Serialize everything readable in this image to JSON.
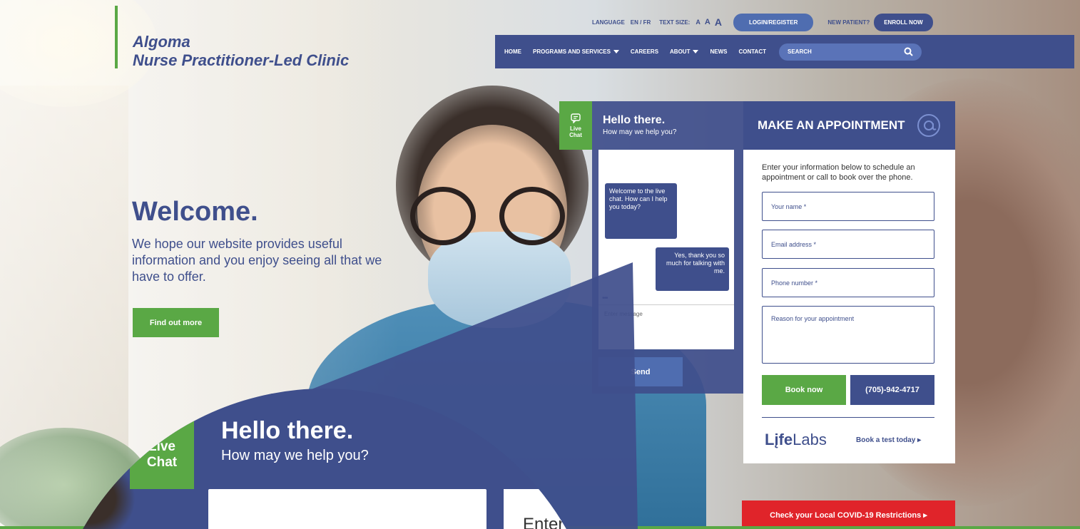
{
  "brand": {
    "line1": "Algoma",
    "line2": "Nurse Practitioner-Led Clinic"
  },
  "utility": {
    "language_label": "LANGUAGE",
    "language_value": "EN / FR",
    "text_size_label": "TEXT SIZE:",
    "text_size_small": "A",
    "text_size_medium": "A",
    "text_size_large": "A",
    "login": "LOGIN/REGISTER",
    "new_patient": "NEW PATIENT?",
    "enroll": "ENROLL NOW"
  },
  "nav": {
    "home": "HOME",
    "programs": "PROGRAMS AND SERVICES",
    "careers": "CAREERS",
    "about": "ABOUT",
    "news": "NEWS",
    "contact": "CONTACT",
    "search_placeholder": "SEARCH"
  },
  "welcome": {
    "title": "Welcome.",
    "text": "We hope our website provides useful information and you enjoy seeing all that we have to offer.",
    "button": "Find out more"
  },
  "chat": {
    "tab_line1": "Live",
    "tab_line2": "Chat",
    "title": "Hello there.",
    "subtitle": "How may we help you?",
    "msg_in": "Welcome to the live chat. How can I help you today?",
    "msg_out": "Yes, thank you so much for talking with me.",
    "typing": "•••",
    "input_placeholder": "Enter message",
    "send": "Send"
  },
  "appointment": {
    "title": "MAKE AN APPOINTMENT",
    "intro": "Enter your information below to schedule an appointment or call to book over the phone.",
    "name_placeholder": "Your name *",
    "email_placeholder": "Email address *",
    "phone_placeholder": "Phone number *",
    "reason_placeholder": "Reason for your appointment",
    "book": "Book now",
    "phone": "(705)-942-4717",
    "lifelabs_prefix": "Lįfe",
    "lifelabs_suffix": "Labs",
    "book_test": "Book a test today ▸"
  },
  "covid": "Check your Local COVID-19 Restrictions ▸",
  "zoom": {
    "tab_line1": "Live",
    "tab_line2": "Chat",
    "title": "Hello there.",
    "subtitle": "How may we help you?",
    "enter": "Enter"
  },
  "colors": {
    "navy": "#3f4f8c",
    "green": "#5aa845",
    "red": "#e0242a",
    "light_blue": "#4f6db0"
  }
}
